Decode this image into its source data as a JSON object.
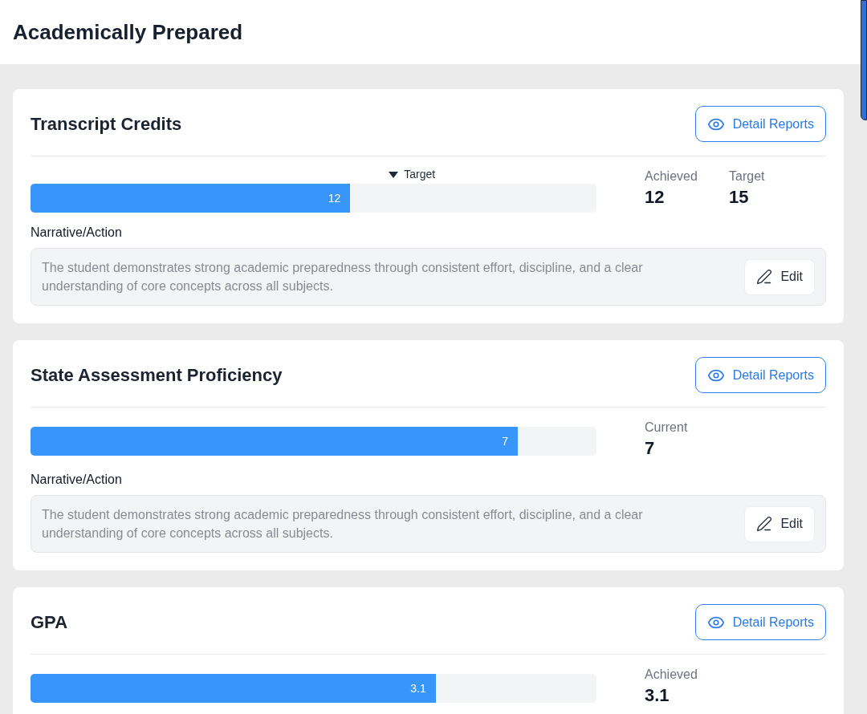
{
  "header": {
    "title": "Academically Prepared"
  },
  "cards": [
    {
      "title": "Transcript Credits",
      "button": "Detail Reports",
      "bar": {
        "level": 0.565,
        "label": "12",
        "marker": {
          "label": "Target",
          "level": 0.633
        }
      },
      "stats": [
        {
          "label": "Achieved",
          "value": "12"
        },
        {
          "label": "Target",
          "value": "15"
        }
      ],
      "narrative": {
        "label": "Narrative/Action",
        "text": "The student demonstrates strong academic preparedness through consistent effort, discipline, and a clear understanding of core concepts across all subjects.",
        "button": "Edit"
      }
    },
    {
      "title": "State Assessment Proficiency",
      "button": "Detail Reports",
      "bar": {
        "level": 0.861,
        "label": "7"
      },
      "stats": [
        {
          "label": "Current",
          "value": "7"
        }
      ],
      "narrative": {
        "label": "Narrative/Action",
        "text": "The student demonstrates strong academic preparedness through consistent effort, discipline, and a clear understanding of core concepts across all subjects.",
        "button": "Edit"
      }
    },
    {
      "title": "GPA",
      "button": "Detail Reports",
      "bar": {
        "level": 0.716,
        "label": "3.1"
      },
      "stats": [
        {
          "label": "Achieved",
          "value": "3.1"
        }
      ]
    }
  ]
}
